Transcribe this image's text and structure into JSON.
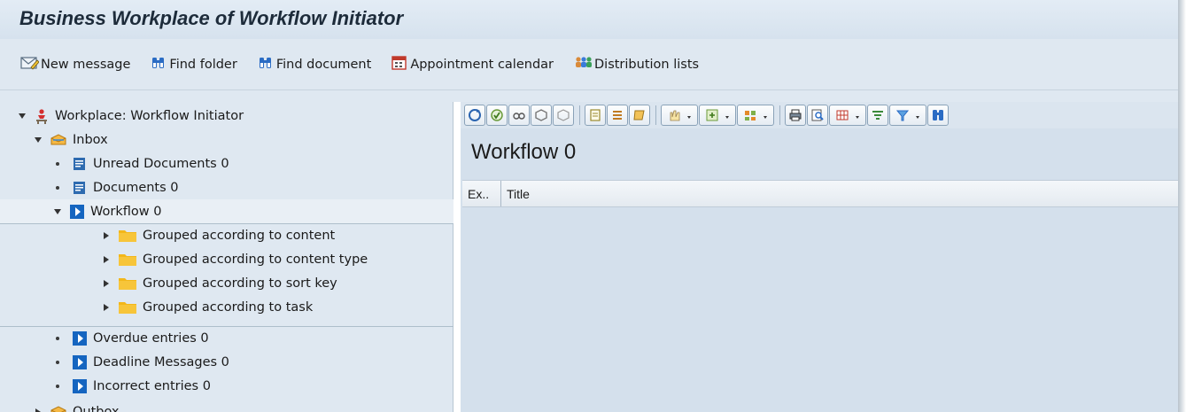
{
  "window": {
    "title": "Business Workplace of Workflow Initiator"
  },
  "toolbar": {
    "items": [
      {
        "label": "New message",
        "icon": "new-message-icon"
      },
      {
        "label": "Find folder",
        "icon": "binoculars-icon"
      },
      {
        "label": "Find document",
        "icon": "binoculars-icon"
      },
      {
        "label": "Appointment calendar",
        "icon": "calendar-icon"
      },
      {
        "label": "Distribution lists",
        "icon": "distribution-list-icon"
      }
    ]
  },
  "tree": {
    "root": "Workplace: Workflow Initiator",
    "inbox": "Inbox",
    "unread": "Unread Documents 0",
    "documents": "Documents 0",
    "workflow": "Workflow 0",
    "grouped": [
      "Grouped according to content",
      "Grouped according to content type",
      "Grouped according to sort key",
      "Grouped according to task"
    ],
    "overdue": "Overdue entries 0",
    "deadline": "Deadline Messages 0",
    "incorrect": "Incorrect entries 0",
    "outbox": "Outbox"
  },
  "pane": {
    "title": "Workflow 0",
    "columns": {
      "ex": "Ex..",
      "title": "Title"
    }
  },
  "colors": {
    "background": "#dfe8f1",
    "folder": "#f3b71a",
    "workflow_icon": "#1565c0"
  }
}
